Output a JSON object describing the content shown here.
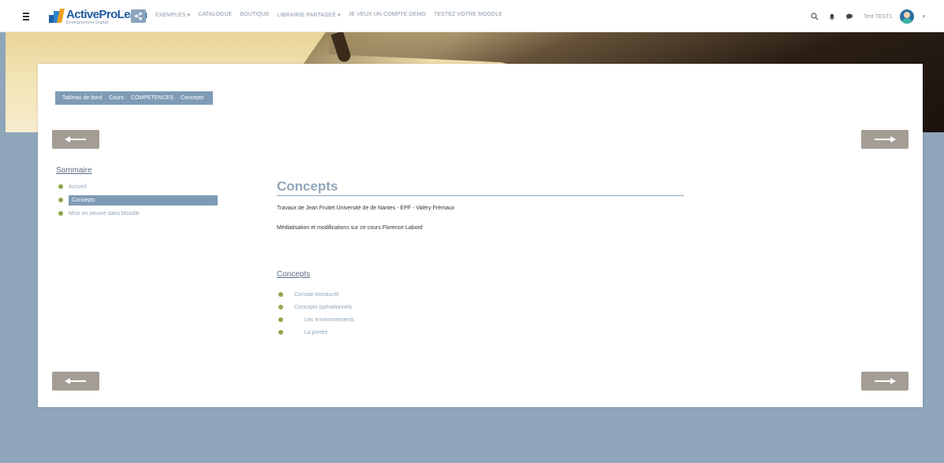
{
  "navbar": {
    "logo_text": "ActiveProLearn",
    "logo_subtext": "Enseignement Digital",
    "menu": [
      {
        "label": "EXEMPLES ▾"
      },
      {
        "label": "CATALOGUE"
      },
      {
        "label": "BOUTIQUE"
      },
      {
        "label": "LIBRAIRIE PARTAGEE ▾"
      },
      {
        "label": "JE VEUX UN COMPTE DEMO"
      },
      {
        "label": "TESTEZ VOTRE MOODLE"
      }
    ],
    "user_name": "Test TEST1",
    "caret": "▾"
  },
  "breadcrumb": [
    "Tableau de bord",
    "Cours",
    "COMPETENCES",
    "Concepts"
  ],
  "sommaire": {
    "title": "Sommaire",
    "items": [
      {
        "label": "Accueil"
      },
      {
        "label": "Concepts"
      },
      {
        "label": "Mise en oeuvre dans Moodle"
      }
    ]
  },
  "content": {
    "title": "Concepts",
    "line1": "Travaux de Jean Fruitet Université de de Nantes -   EPF - Valéry Frémaux",
    "line2": "Médiatisation et modifications sur ce cours Florence Labord",
    "subtitle": "Concepts",
    "concepts": [
      {
        "label": "Constat introductif"
      },
      {
        "label": "Concepts opérationnels"
      },
      {
        "label": "Les environnements"
      },
      {
        "label": "La portée"
      }
    ]
  },
  "colors": {
    "accent": "#7f9bb6",
    "background": "#8fa5b9",
    "bullet": "#8fa84c",
    "arrow_button": "#a49d95"
  }
}
